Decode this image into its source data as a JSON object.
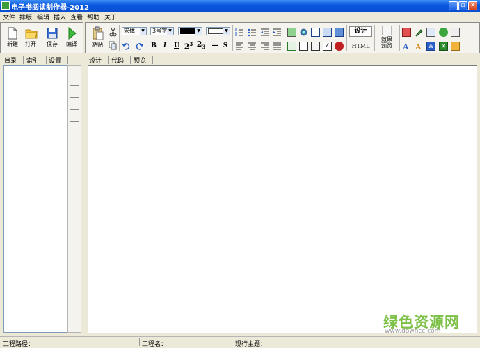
{
  "window": {
    "title": "电子书阅读制作器-2012"
  },
  "menu": [
    "文件",
    "排版",
    "编辑",
    "插入",
    "查看",
    "帮助",
    "关于"
  ],
  "file_toolbar": {
    "new": "新建",
    "open": "打开",
    "save": "保存",
    "compile": "编译"
  },
  "edit_toolbar": {
    "paste": "粘贴",
    "font": "宋体",
    "size": "3号字",
    "bold": "B",
    "italic": "I",
    "underline": "U",
    "superscript": "2",
    "superscript_exp": "3",
    "subscript": "2",
    "subscript_exp": "3",
    "hr": "—",
    "strike": "S",
    "design": "设计",
    "html": "HTML",
    "preview_effect": "效果预览"
  },
  "left_tabs": [
    "目录",
    "索引",
    "设置"
  ],
  "editor_tabs": [
    "设计",
    "代码",
    "预览"
  ],
  "status": {
    "path_label": "工程路径：",
    "name_label": "工程名：",
    "theme_label": "现行主题："
  },
  "watermark": {
    "brand": "绿色资源网",
    "url": "www.downcc.com"
  },
  "colors": {
    "title_bar": "#0a4fd0",
    "panel_bg": "#ece9d8",
    "watermark": "#7cc046"
  }
}
